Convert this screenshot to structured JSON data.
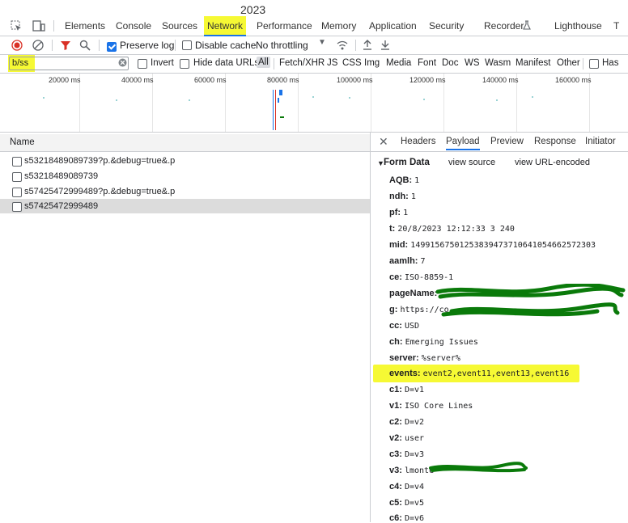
{
  "top_year": "2023",
  "devtools_tabs": [
    "Elements",
    "Console",
    "Sources",
    "Network",
    "Performance",
    "Memory",
    "Application",
    "Security",
    "Recorder",
    "Lighthouse",
    "T"
  ],
  "toolbar": {
    "preserve_log": "Preserve log",
    "disable_cache": "Disable cache",
    "throttling": "No throttling"
  },
  "filter": {
    "value": "b/ss",
    "invert": "Invert",
    "hide_data_urls": "Hide data URLs",
    "types": [
      "All",
      "Fetch/XHR",
      "JS",
      "CSS",
      "Img",
      "Media",
      "Font",
      "Doc",
      "WS",
      "Wasm",
      "Manifest",
      "Other"
    ],
    "has": "Has"
  },
  "timeline_ticks": [
    "20000 ms",
    "40000 ms",
    "60000 ms",
    "80000 ms",
    "100000 ms",
    "120000 ms",
    "140000 ms",
    "160000 ms"
  ],
  "requests": {
    "header": "Name",
    "rows": [
      "s53218489089739?p.&debug=true&.p",
      "s53218489089739",
      "s57425472999489?p.&debug=true&.p",
      "s57425472999489"
    ]
  },
  "details": {
    "tabs": [
      "Headers",
      "Payload",
      "Preview",
      "Response",
      "Initiator"
    ],
    "form_data_label": "Form Data",
    "view_source": "view source",
    "view_url_encoded": "view URL-encoded",
    "fields": [
      {
        "k": "AQB:",
        "v": "1"
      },
      {
        "k": "ndh:",
        "v": "1"
      },
      {
        "k": "pf:",
        "v": "1"
      },
      {
        "k": "t:",
        "v": "20/8/2023 12:12:33 3 240"
      },
      {
        "k": "mid:",
        "v": "14991567501253839473710641054662572303"
      },
      {
        "k": "aamlh:",
        "v": "7"
      },
      {
        "k": "ce:",
        "v": "ISO-8859-1"
      },
      {
        "k": "pageName:",
        "v": ""
      },
      {
        "k": "g:",
        "v": "https://co"
      },
      {
        "k": "cc:",
        "v": "USD"
      },
      {
        "k": "ch:",
        "v": "Emerging Issues"
      },
      {
        "k": "server:",
        "v": "%server%"
      },
      {
        "k": "events:",
        "v": "event2,event11,event13,event16"
      },
      {
        "k": "c1:",
        "v": "D=v1"
      },
      {
        "k": "v1:",
        "v": "ISO Core Lines"
      },
      {
        "k": "c2:",
        "v": "D=v2"
      },
      {
        "k": "v2:",
        "v": "user"
      },
      {
        "k": "c3:",
        "v": "D=v3"
      },
      {
        "k": "v3:",
        "v": "lmonte"
      },
      {
        "k": "c4:",
        "v": "D=v4"
      },
      {
        "k": "c5:",
        "v": "D=v5"
      },
      {
        "k": "c6:",
        "v": "D=v6"
      }
    ]
  },
  "colors": {
    "accent": "#1a73e8",
    "highlight": "#f6f934",
    "scribble": "#0a7a0a",
    "record": "#d93025"
  }
}
